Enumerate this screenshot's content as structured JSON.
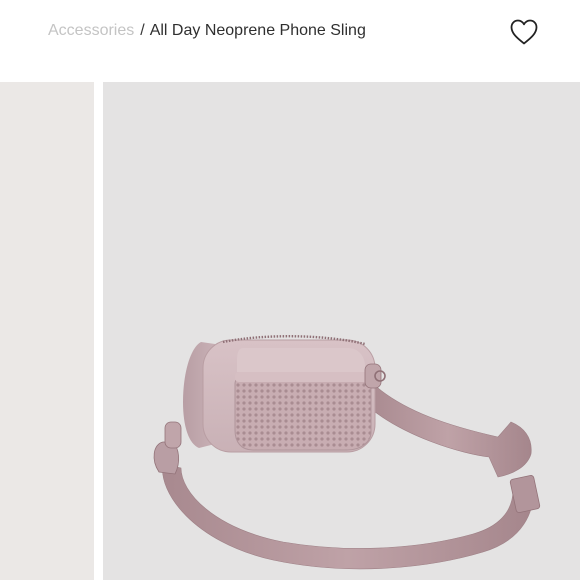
{
  "breadcrumb": {
    "parent": "Accessories",
    "separator": "/",
    "current": "All Day Neoprene Phone Sling"
  },
  "wishlist": {
    "icon": "heart-outline-icon"
  },
  "product_image": {
    "description_icon": "phone-sling-bag-image",
    "colors": {
      "background": "#e4e3e3",
      "thumb_background": "#ebe8e6",
      "bag": "#d7c0c4",
      "bag_shadow": "#b79ea3",
      "strap": "#ad8e94"
    }
  }
}
